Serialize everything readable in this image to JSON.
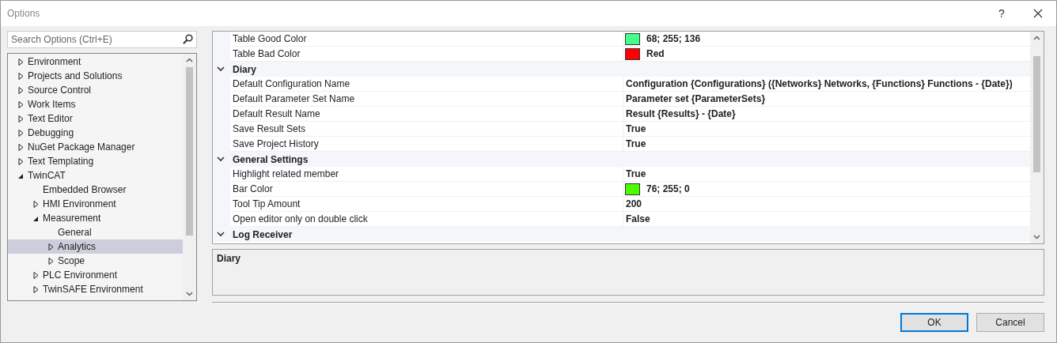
{
  "window": {
    "title": "Options",
    "help_button": "?"
  },
  "search": {
    "placeholder": "Search Options (Ctrl+E)"
  },
  "tree": [
    {
      "label": "Environment",
      "expanded": false,
      "selected": false
    },
    {
      "label": "Projects and Solutions",
      "expanded": false,
      "selected": false
    },
    {
      "label": "Source Control",
      "expanded": false,
      "selected": false
    },
    {
      "label": "Work Items",
      "expanded": false,
      "selected": false
    },
    {
      "label": "Text Editor",
      "expanded": false,
      "selected": false
    },
    {
      "label": "Debugging",
      "expanded": false,
      "selected": false
    },
    {
      "label": "NuGet Package Manager",
      "expanded": false,
      "selected": false
    },
    {
      "label": "Text Templating",
      "expanded": false,
      "selected": false
    },
    {
      "label": "TwinCAT",
      "expanded": true,
      "selected": false,
      "children": [
        {
          "label": "Embedded Browser",
          "selected": false
        },
        {
          "label": "HMI Environment",
          "expanded": false,
          "selected": false
        },
        {
          "label": "Measurement",
          "expanded": true,
          "selected": false,
          "children": [
            {
              "label": "General",
              "selected": false
            },
            {
              "label": "Analytics",
              "expanded": false,
              "selected": true
            },
            {
              "label": "Scope",
              "expanded": false,
              "selected": false
            }
          ]
        },
        {
          "label": "PLC Environment",
          "expanded": false,
          "selected": false
        },
        {
          "label": "TwinSAFE Environment",
          "expanded": false,
          "selected": false
        }
      ]
    }
  ],
  "properties": [
    {
      "items": [
        {
          "name": "Table Good Color",
          "value": "68; 255; 136",
          "color": "#44ff88"
        },
        {
          "name": "Table Bad Color",
          "value": "Red",
          "color": "#ff0000"
        }
      ]
    },
    {
      "name": "Diary",
      "expanded": true,
      "items": [
        {
          "name": "Default Configuration Name",
          "value": "Configuration {Configurations} ({Networks} Networks, {Functions} Functions - {Date})"
        },
        {
          "name": "Default Parameter Set Name",
          "value": "Parameter set {ParameterSets}"
        },
        {
          "name": "Default Result Name",
          "value": "Result {Results} - {Date}"
        },
        {
          "name": "Save Result Sets",
          "value": "True"
        },
        {
          "name": "Save Project History",
          "value": "True"
        }
      ]
    },
    {
      "name": "General Settings",
      "expanded": true,
      "items": [
        {
          "name": "Highlight related member",
          "value": "True"
        },
        {
          "name": "Bar Color",
          "value": "76; 255; 0",
          "color": "#4cff00"
        },
        {
          "name": "Tool Tip Amount",
          "value": "200"
        },
        {
          "name": "Open editor only on double click",
          "value": "False"
        }
      ]
    },
    {
      "name": "Log Receiver",
      "expanded": true
    }
  ],
  "description": {
    "title": "Diary"
  },
  "buttons": [
    {
      "label": "OK",
      "default": true
    },
    {
      "label": "Cancel",
      "default": false
    }
  ]
}
